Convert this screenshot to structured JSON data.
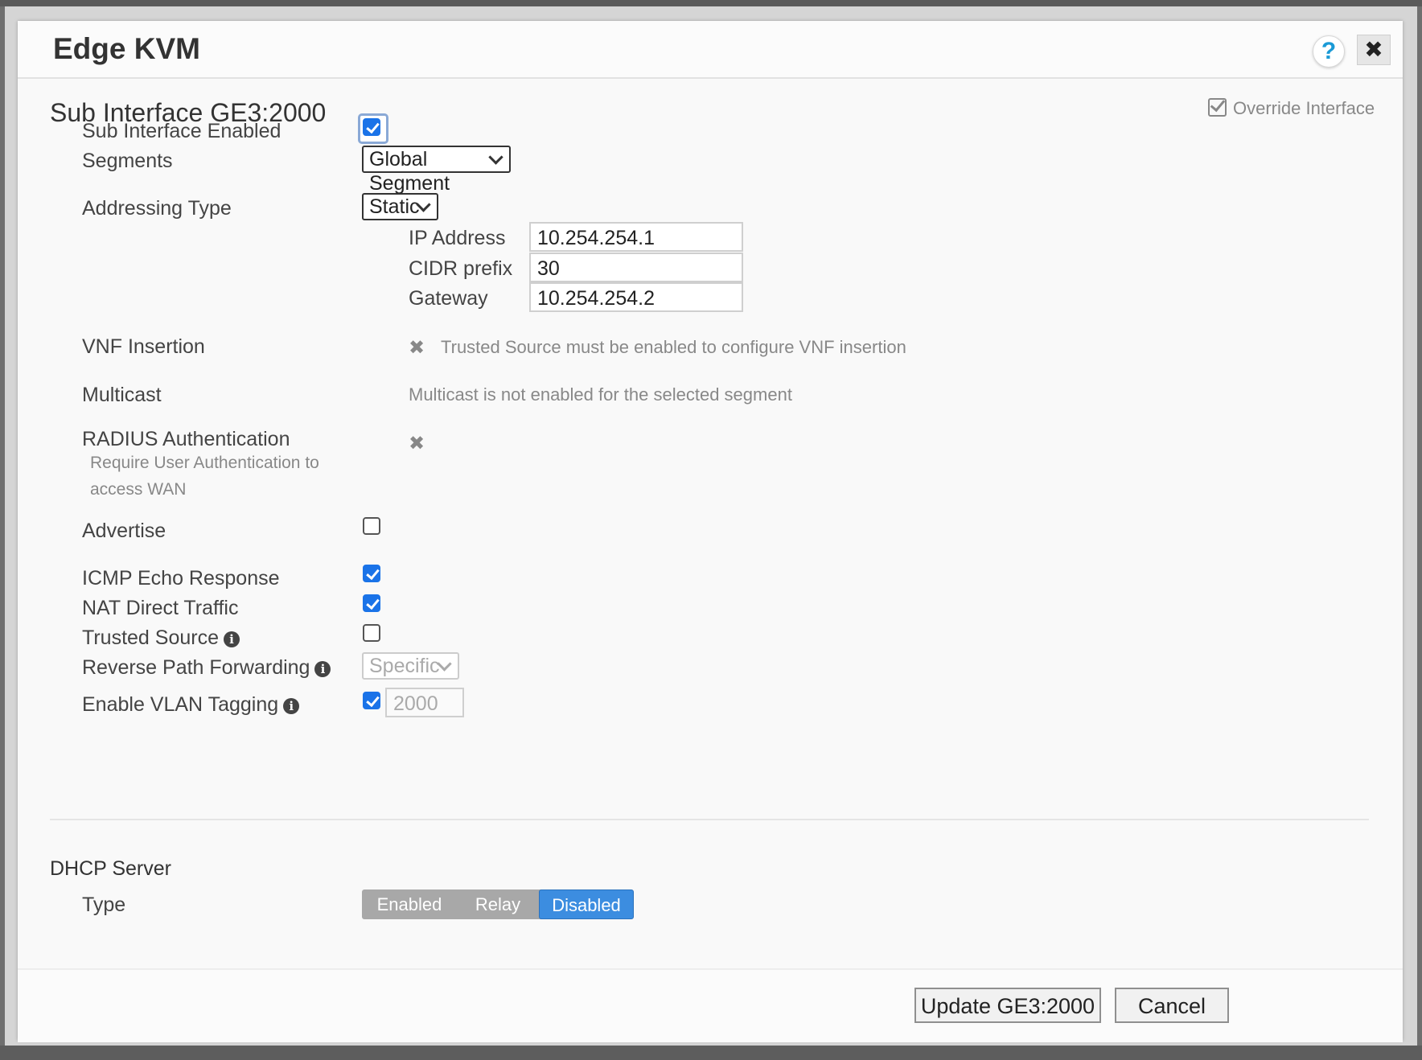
{
  "dialog": {
    "title": "Edge KVM",
    "help_icon": "question-icon",
    "close_icon": "close-icon",
    "help_glyph": "?",
    "close_glyph": "✖"
  },
  "subinterface": {
    "title": "Sub Interface GE3:2000",
    "override_label": "Override Interface",
    "override_checked": true
  },
  "fields": {
    "sub_interface_enabled": {
      "label": "Sub Interface Enabled",
      "checked": true
    },
    "segments": {
      "label": "Segments",
      "value": "Global Segment"
    },
    "addressing_type": {
      "label": "Addressing Type",
      "value": "Static"
    },
    "ip_address": {
      "label": "IP Address",
      "value": "10.254.254.1"
    },
    "cidr_prefix": {
      "label": "CIDR prefix",
      "value": "30"
    },
    "gateway": {
      "label": "Gateway",
      "value": "10.254.254.2"
    },
    "vnf_insertion": {
      "label": "VNF Insertion",
      "message": "Trusted Source must be enabled to configure VNF insertion"
    },
    "multicast": {
      "label": "Multicast",
      "message": "Multicast is not enabled for the selected segment"
    },
    "radius": {
      "label": "RADIUS Authentication",
      "sublabel": "Require User Authentication to access WAN"
    },
    "advertise": {
      "label": "Advertise",
      "checked": false
    },
    "icmp_echo": {
      "label": "ICMP Echo Response",
      "checked": true
    },
    "nat_direct": {
      "label": "NAT Direct Traffic",
      "checked": true
    },
    "trusted_source": {
      "label": "Trusted Source",
      "checked": false
    },
    "reverse_path": {
      "label": "Reverse Path Forwarding",
      "value": "Specific"
    },
    "vlan_tagging": {
      "label": "Enable VLAN Tagging",
      "checked": true,
      "value": "2000"
    }
  },
  "x_glyph": "✖",
  "info_glyph": "i",
  "dhcp": {
    "title": "DHCP Server",
    "type_label": "Type",
    "options": [
      "Enabled",
      "Relay",
      "Disabled"
    ],
    "selected": "Disabled",
    "colors": {
      "active": "#3c8de0",
      "inactive": "#a8a8a8"
    }
  },
  "footer": {
    "update_label": "Update GE3:2000",
    "cancel_label": "Cancel"
  },
  "colors": {
    "checkbox_checked": "#1a73e8",
    "help_icon": "#1a9ad6"
  }
}
